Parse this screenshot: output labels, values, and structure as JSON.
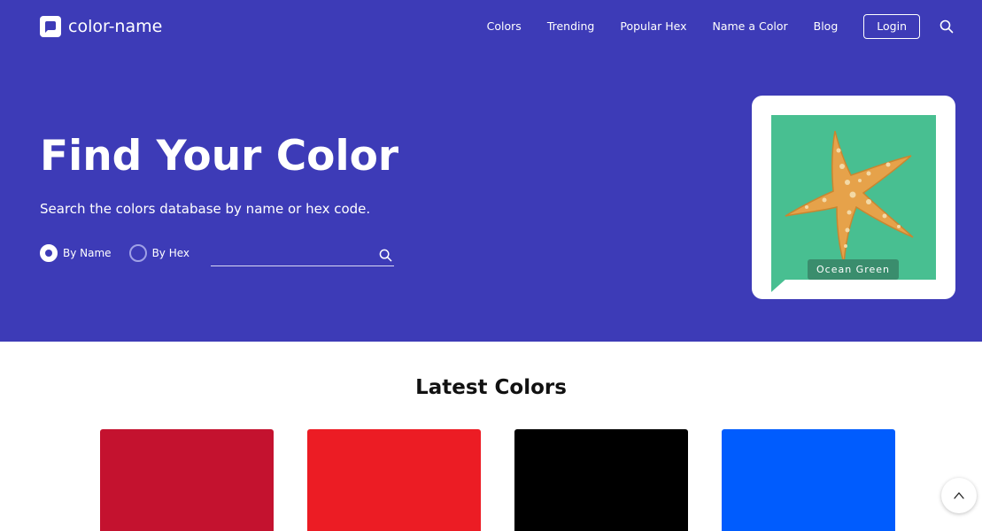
{
  "brand": {
    "name": "color-name",
    "icon": "chat-bubble-icon"
  },
  "nav": {
    "items": [
      {
        "label": "Colors"
      },
      {
        "label": "Trending"
      },
      {
        "label": "Popular Hex"
      },
      {
        "label": "Name a Color"
      },
      {
        "label": "Blog"
      }
    ],
    "login_label": "Login",
    "search_icon": "search-icon"
  },
  "hero": {
    "title": "Find Your Color",
    "subtitle": "Search the colors database by name or hex code.",
    "background": "#3d3bb7",
    "search": {
      "options": [
        {
          "label": "By Name",
          "selected": true
        },
        {
          "label": "By Hex",
          "selected": false
        }
      ],
      "value": "",
      "placeholder": ""
    }
  },
  "featured": {
    "name": "Ocean Green",
    "hex": "#48bf91"
  },
  "latest": {
    "title": "Latest Colors",
    "swatches": [
      "#c4122f",
      "#ec1c24",
      "#000000",
      "#005cfe"
    ]
  },
  "scroll_top_icon": "chevron-up-icon"
}
